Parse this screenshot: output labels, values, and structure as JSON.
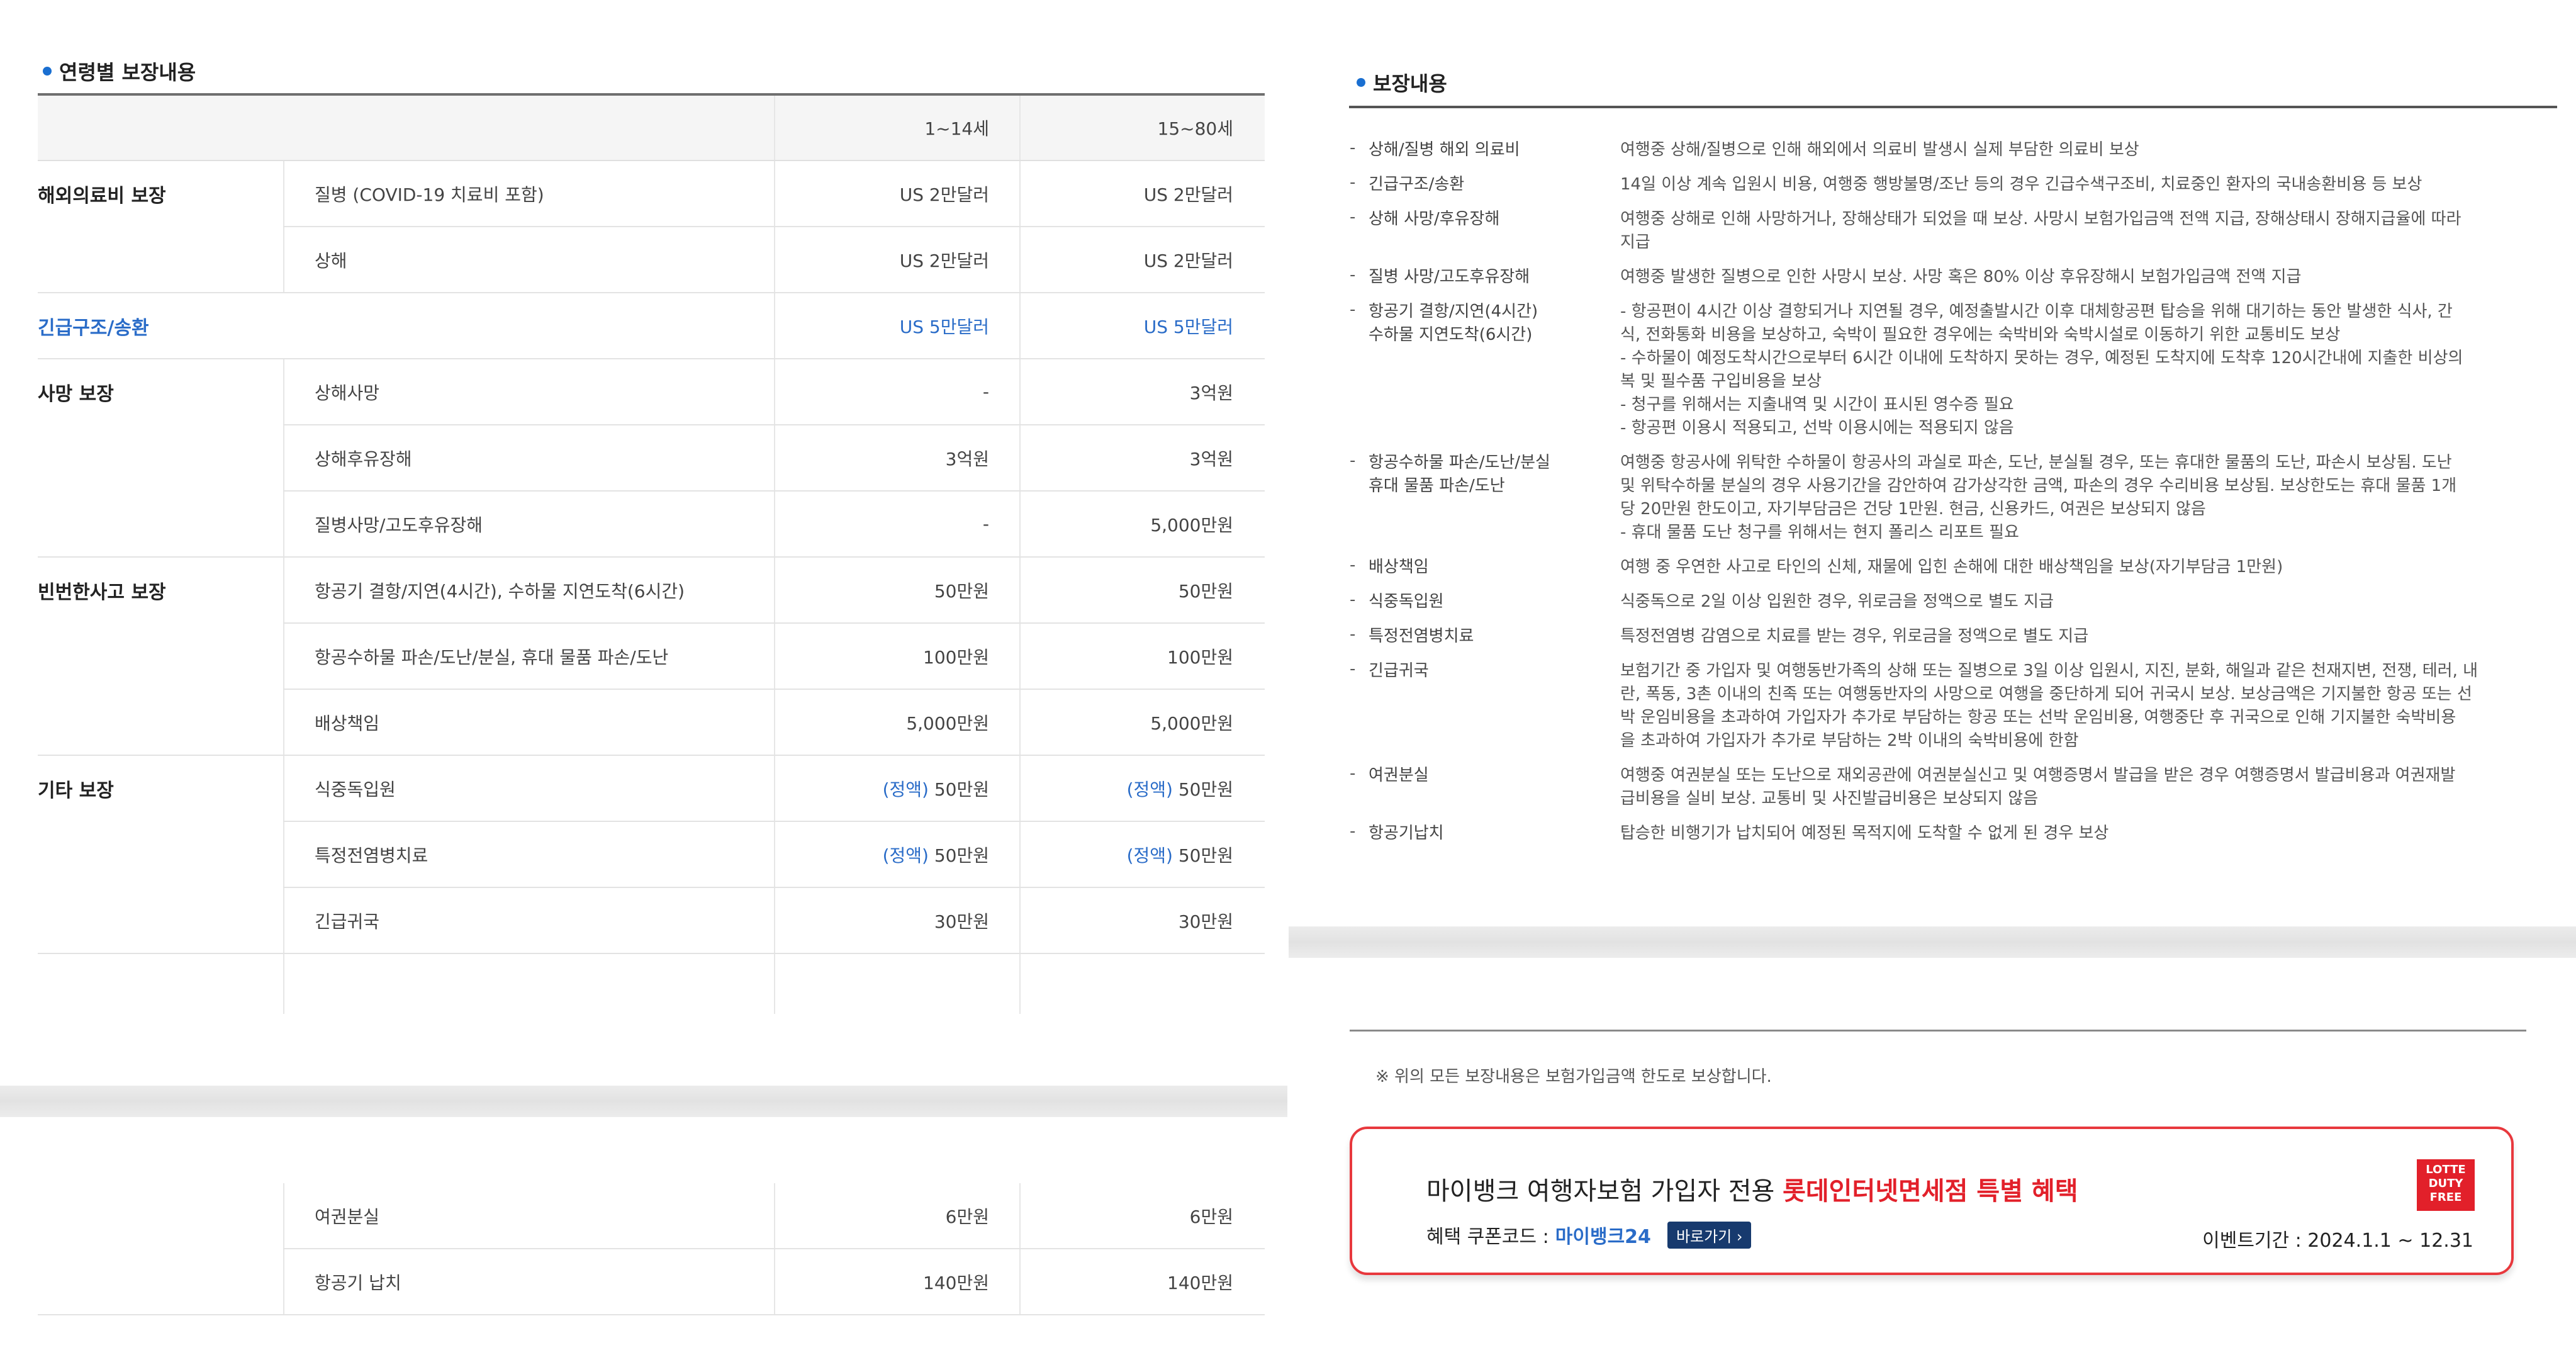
{
  "left": {
    "title": "연령별 보장내용",
    "headers": [
      "",
      "",
      "1~14세",
      "15~80세"
    ],
    "rows": [
      {
        "group": "해외의료비 보장",
        "item": "질병 (COVID-19 치료비 포함)",
        "v1": "US 2만달러",
        "v2": "US 2만달러"
      },
      {
        "group": "",
        "item": "상해",
        "v1": "US 2만달러",
        "v2": "US 2만달러"
      },
      {
        "group": "긴급구조/송환",
        "item": "",
        "v1": "US 5만달러",
        "v2": "US 5만달러"
      },
      {
        "group": "사망 보장",
        "item": "상해사망",
        "v1": "-",
        "v2": "3억원"
      },
      {
        "group": "",
        "item": "상해후유장해",
        "v1": "3억원",
        "v2": "3억원"
      },
      {
        "group": "",
        "item": "질병사망/고도후유장해",
        "v1": "-",
        "v2": "5,000만원"
      },
      {
        "group": "빈번한사고 보장",
        "item": "항공기 결항/지연(4시간), 수하물 지연도착(6시간)",
        "v1": "50만원",
        "v2": "50만원"
      },
      {
        "group": "",
        "item": "항공수하물 파손/도난/분실, 휴대 물품 파손/도난",
        "v1": "100만원",
        "v2": "100만원"
      },
      {
        "group": "",
        "item": "배상책임",
        "v1": "5,000만원",
        "v2": "5,000만원"
      },
      {
        "group": "기타 보장",
        "item": "식중독입원",
        "tag": "(정액)",
        "v1": "50만원",
        "v2": "50만원"
      },
      {
        "group": "",
        "item": "특정전염병치료",
        "tag": "(정액)",
        "v1": "50만원",
        "v2": "50만원"
      },
      {
        "group": "",
        "item": "긴급귀국",
        "v1": "30만원",
        "v2": "30만원"
      }
    ],
    "rows_bottom": [
      {
        "item": "여권분실",
        "v1": "6만원",
        "v2": "6만원"
      },
      {
        "item": "항공기 납치",
        "v1": "140만원",
        "v2": "140만원"
      }
    ]
  },
  "right": {
    "title": "보장내용",
    "items": [
      {
        "label": "상해/질병 해외 의료비",
        "desc": [
          "여행중 상해/질병으로 인해 해외에서 의료비 발생시 실제 부담한 의료비 보상"
        ]
      },
      {
        "label": "긴급구조/송환",
        "desc": [
          "14일 이상 계속 입원시 비용, 여행중 행방불명/조난 등의 경우 긴급수색구조비, 치료중인 환자의 국내송환비용 등 보상"
        ]
      },
      {
        "label": "상해 사망/후유장해",
        "desc": [
          "여행중 상해로 인해 사망하거나, 장해상태가 되었을 때 보상. 사망시 보험가입금액 전액 지급, 장해상태시 장해지급율에 따라",
          "지급"
        ]
      },
      {
        "label": "질병 사망/고도후유장해",
        "desc": [
          "여행중 발생한 질병으로 인한 사망시 보상. 사망 혹은 80% 이상 후유장해시 보험가입금액 전액 지급"
        ]
      },
      {
        "label": "항공기 결항/지연(4시간)\n수하물 지연도착(6시간)",
        "desc": [
          "- 항공편이 4시간 이상 결항되거나 지연될 경우, 예정출발시간 이후 대체항공편 탑승을 위해 대기하는 동안 발생한 식사, 간",
          "식, 전화통화 비용을 보상하고, 숙박이 필요한 경우에는 숙박비와 숙박시설로 이동하기 위한 교통비도 보상",
          "- 수하물이 예정도착시간으로부터 6시간 이내에 도착하지 못하는 경우, 예정된 도착지에 도착후 120시간내에 지출한 비상의",
          "복 및 필수품 구입비용을 보상",
          "- 청구를 위해서는 지출내역 및 시간이 표시된 영수증 필요",
          "- 항공편 이용시 적용되고, 선박 이용시에는 적용되지 않음"
        ]
      },
      {
        "label": "항공수하물 파손/도난/분실\n휴대 물품 파손/도난",
        "desc": [
          "여행중 항공사에 위탁한 수하물이 항공사의 과실로 파손, 도난, 분실될 경우, 또는 휴대한 물품의 도난, 파손시 보상됨. 도난",
          "및 위탁수하물 분실의 경우 사용기간을 감안하여 감가상각한 금액, 파손의 경우 수리비용 보상됨. 보상한도는 휴대 물품 1개",
          "당 20만원 한도이고, 자기부담금은 건당 1만원. 현금, 신용카드, 여권은 보상되지 않음",
          "- 휴대 물품 도난 청구를 위해서는 현지 폴리스 리포트 필요"
        ]
      },
      {
        "label": "배상책임",
        "desc": [
          "여행 중 우연한 사고로 타인의 신체, 재물에 입힌 손해에 대한 배상책임을 보상(자기부담금 1만원)"
        ]
      },
      {
        "label": "식중독입원",
        "desc": [
          "식중독으로 2일 이상 입원한 경우, 위로금을 정액으로 별도 지급"
        ]
      },
      {
        "label": "특정전염병치료",
        "desc": [
          "특정전염병 감염으로 치료를 받는 경우, 위로금을 정액으로 별도 지급"
        ]
      },
      {
        "label": "긴급귀국",
        "desc": [
          "보험기간 중 가입자 및 여행동반가족의 상해 또는 질병으로 3일 이상 입원시, 지진, 분화, 해일과 같은 천재지변, 전쟁, 테러, 내",
          "란, 폭동, 3촌 이내의 친족 또는 여행동반자의 사망으로 여행을 중단하게 되어 귀국시 보상. 보상금액은 기지불한 항공 또는 선",
          "박 운임비용을 초과하여 가입자가 추가로 부담하는 항공 또는 선박 운임비용, 여행중단 후 귀국으로 인해 기지불한 숙박비용",
          "을 초과하여 가입자가 추가로 부담하는 2박 이내의 숙박비용에 한함"
        ]
      },
      {
        "label": "여권분실",
        "desc": [
          "여행중 여권분실 또는 도난으로 재외공관에 여권분실신고 및 여행증명서 발급을 받은 경우 여행증명서 발급비용과 여권재발",
          "급비용을 실비 보상. 교통비 및 사진발급비용은 보상되지 않음"
        ]
      },
      {
        "label": "항공기납치",
        "desc": [
          "탑승한 비행기가 납치되어 예정된 목적지에 도착할 수 없게 된 경우 보상"
        ]
      }
    ],
    "note": "※ 위의 모든 보장내용은 보험가입금액 한도로 보상합니다."
  },
  "banner": {
    "title_prefix": "마이뱅크 여행자보험 가입자 전용 ",
    "title_highlight": "롯데인터넷면세점 특별 혜택",
    "coupon_label": "혜택 쿠폰코드 :",
    "coupon_code": "마이뱅크24",
    "go_label": "바로가기 ›",
    "event_period": "이벤트기간 : 2024.1.1 ~ 12.31",
    "logo_text": "LOTTE DUTY FREE",
    "colors": {
      "accent_red": "#e2202a",
      "link_blue": "#2a6cc8",
      "button_navy": "#173a6e"
    }
  }
}
